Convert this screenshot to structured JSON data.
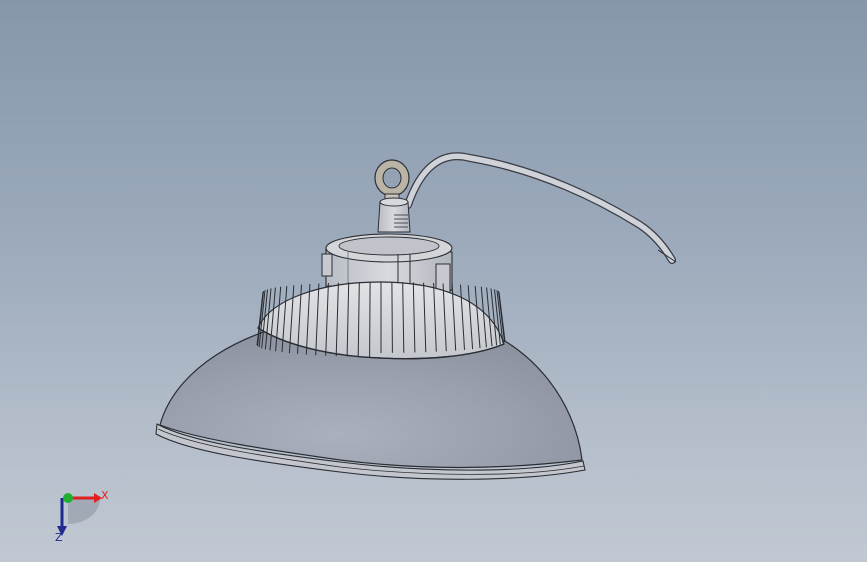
{
  "viewport": {
    "background_top": "#8697ab",
    "background_bottom": "#c1c8d2"
  },
  "model": {
    "name": "high-bay-lamp",
    "parts": [
      "lifting-eye-ring",
      "neck-connector",
      "driver-housing",
      "heat-sink-fins",
      "reflector-shade",
      "shade-rim",
      "power-cable"
    ],
    "colors": {
      "shade": "#a3a8b5",
      "body": "#c9ccd2",
      "fins": "#d6d8dd",
      "outline": "#2a2d33",
      "eye": "#b9b4a6"
    }
  },
  "triad": {
    "x_label": "X",
    "z_label": "Z",
    "x_color": "#e02020",
    "y_color": "#20b030",
    "z_color": "#1f2a8f"
  }
}
